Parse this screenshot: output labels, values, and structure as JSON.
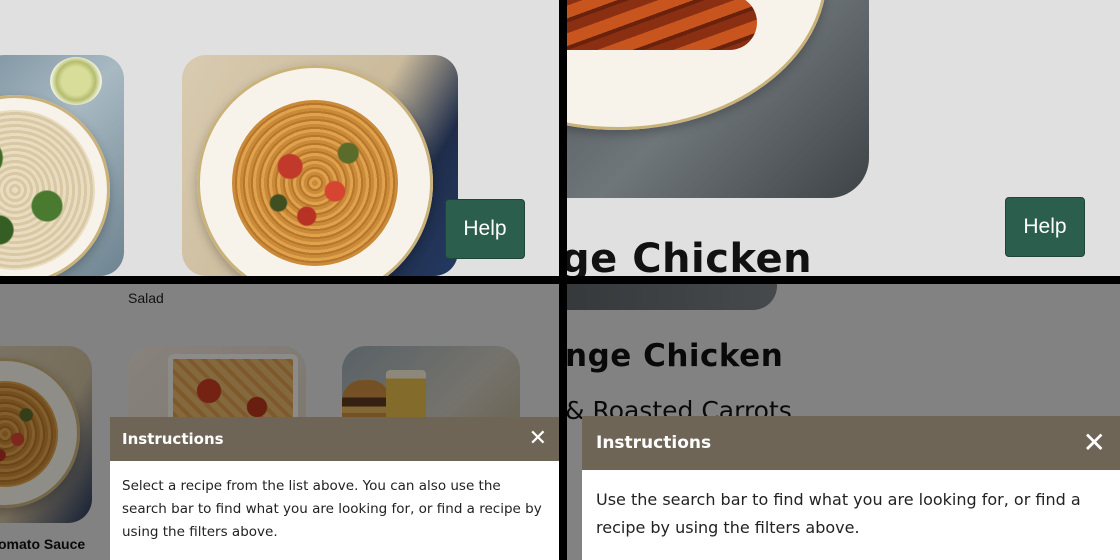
{
  "panel1": {
    "help_label": "Help"
  },
  "panel2": {
    "title_fragment": "ge Chicken",
    "help_label": "Help"
  },
  "panel3": {
    "salad_caption": "Salad",
    "recipe_caption": "omato Sauce",
    "modal": {
      "title": "Instructions",
      "close_glyph": "✕",
      "body": "Select a recipe from the list above. You can also use the search bar to find what you are looking for, or find a recipe by using the filters above."
    }
  },
  "panel4": {
    "title_fragment": "nge Chicken",
    "subtitle_fragment": "& Roasted Carrots",
    "modal": {
      "title": "Instructions",
      "close_glyph": "✕",
      "body": "Use the search bar to find what you are looking for, or find a recipe by using the filters above."
    }
  },
  "colors": {
    "help_green": "#2b5e4c",
    "modal_header": "#6f6556",
    "page_bg": "#e0e0e0"
  }
}
